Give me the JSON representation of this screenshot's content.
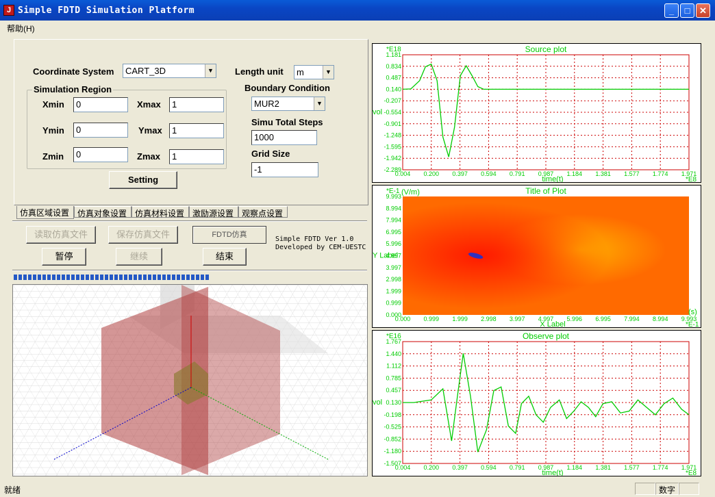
{
  "window": {
    "title": "Simple FDTD Simulation Platform",
    "icon_glyph": "J"
  },
  "menu": {
    "help": "帮助(H)"
  },
  "form": {
    "coord_label": "Coordinate  System",
    "coord_value": "CART_3D",
    "length_label": "Length unit",
    "length_value": "m",
    "region_label": "Simulation Region",
    "xmin_label": "Xmin",
    "xmin": "0",
    "xmax_label": "Xmax",
    "xmax": "1",
    "ymin_label": "Ymin",
    "ymin": "0",
    "ymax_label": "Ymax",
    "ymax": "1",
    "zmin_label": "Zmin",
    "zmin": "0",
    "zmax_label": "Zmax",
    "zmax": "1",
    "boundary_label": "Boundary Condition",
    "boundary_value": "MUR2",
    "steps_label": "Simu Total Steps",
    "steps_value": "1000",
    "grid_label": "Grid Size",
    "grid_value": "-1",
    "setting_button": "Setting"
  },
  "tabs": [
    "仿真区域设置",
    "仿真对象设置",
    "仿真材料设置",
    "激励源设置",
    "观察点设置"
  ],
  "actions": {
    "read_file": "读取仿真文件",
    "save_file": "保存仿真文件",
    "fdtd_sim": "FDTD仿真",
    "pause": "暂停",
    "resume": "继续",
    "end": "结束"
  },
  "version_text": "Simple FDTD Ver 1.0\nDeveloped by CEM-UESTC",
  "progress": {
    "segments_filled": 41
  },
  "status": {
    "left": "就绪",
    "num": "数字"
  },
  "colors": {
    "plot_text": "#00cc00",
    "plot_grid": "#cc0000",
    "plot_frame": "#cc0000",
    "title_bar": "#0a50cc"
  },
  "chart_data": [
    {
      "type": "line",
      "title": "Source plot",
      "exponent_label": "*E18",
      "ylabel": "vol",
      "xlabel": "time(t)",
      "x_exponent": "*E8",
      "yticks": [
        "1.181",
        "0.834",
        "0.487",
        "0.140",
        "-0.207",
        "-0.554",
        "-0.901",
        "-1.248",
        "-1.595",
        "-1.942",
        "-2.289"
      ],
      "xticks": [
        "0.004",
        "0.200",
        "0.397",
        "0.594",
        "0.791",
        "0.987",
        "1.184",
        "1.381",
        "1.577",
        "1.774",
        "1.971"
      ],
      "ylim": [
        -2.289,
        1.181
      ],
      "xlim": [
        0.004,
        1.971
      ],
      "x": [
        0.004,
        0.06,
        0.12,
        0.16,
        0.2,
        0.24,
        0.28,
        0.32,
        0.36,
        0.4,
        0.44,
        0.48,
        0.52,
        0.56,
        0.6,
        0.7,
        0.8,
        1.0,
        1.2,
        1.4,
        1.6,
        1.8,
        1.971
      ],
      "y": [
        0.14,
        0.15,
        0.4,
        0.82,
        0.9,
        0.4,
        -1.3,
        -1.9,
        -1.0,
        0.55,
        0.85,
        0.55,
        0.22,
        0.14,
        0.14,
        0.14,
        0.14,
        0.14,
        0.14,
        0.14,
        0.14,
        0.14,
        0.14
      ]
    },
    {
      "type": "heatmap",
      "title": "Title of Plot",
      "exponent_label": "*E-1",
      "unit_label": "(V/m)",
      "ylabel": "Y Label",
      "xlabel": "X Label",
      "x_unit": "(s)",
      "x_exponent": "*E-1",
      "yticks": [
        "9.993",
        "8.994",
        "7.994",
        "6.995",
        "5.996",
        "4.997",
        "3.997",
        "2.998",
        "1.999",
        "0.999",
        "0.000"
      ],
      "xticks": [
        "0.000",
        "0.999",
        "1.999",
        "2.998",
        "3.997",
        "4.997",
        "5.996",
        "6.995",
        "7.994",
        "8.994",
        "9.993"
      ],
      "colors": {
        "base": "#ff6a00",
        "hot": "#ff1a00",
        "warm": "#ffb000"
      }
    },
    {
      "type": "line",
      "title": "Observe plot",
      "exponent_label": "*E16",
      "ylabel": "vol",
      "xlabel": "time(t)",
      "x_exponent": "*E8",
      "yticks": [
        "1.767",
        "1.440",
        "1.112",
        "0.785",
        "0.457",
        "0.130",
        "-0.198",
        "-0.525",
        "-0.852",
        "-1.180",
        "-1.507"
      ],
      "xticks": [
        "0.004",
        "0.200",
        "0.397",
        "0.594",
        "0.791",
        "0.987",
        "1.184",
        "1.381",
        "1.577",
        "1.774",
        "1.971"
      ],
      "ylim": [
        -1.507,
        1.767
      ],
      "xlim": [
        0.004,
        1.971
      ],
      "x": [
        0.004,
        0.08,
        0.2,
        0.28,
        0.34,
        0.38,
        0.42,
        0.47,
        0.52,
        0.58,
        0.63,
        0.68,
        0.73,
        0.78,
        0.82,
        0.87,
        0.92,
        0.97,
        1.02,
        1.08,
        1.13,
        1.18,
        1.23,
        1.28,
        1.33,
        1.38,
        1.44,
        1.5,
        1.56,
        1.62,
        1.68,
        1.74,
        1.8,
        1.86,
        1.92,
        1.971
      ],
      "y": [
        0.13,
        0.13,
        0.2,
        0.5,
        -0.9,
        0.3,
        1.45,
        0.3,
        -1.2,
        -0.6,
        0.45,
        0.55,
        -0.5,
        -0.7,
        0.1,
        0.3,
        -0.2,
        -0.4,
        0.0,
        0.2,
        -0.3,
        -0.1,
        0.15,
        0.0,
        -0.25,
        0.1,
        0.15,
        -0.15,
        -0.1,
        0.2,
        0.0,
        -0.2,
        0.1,
        0.25,
        -0.05,
        -0.2
      ]
    }
  ]
}
